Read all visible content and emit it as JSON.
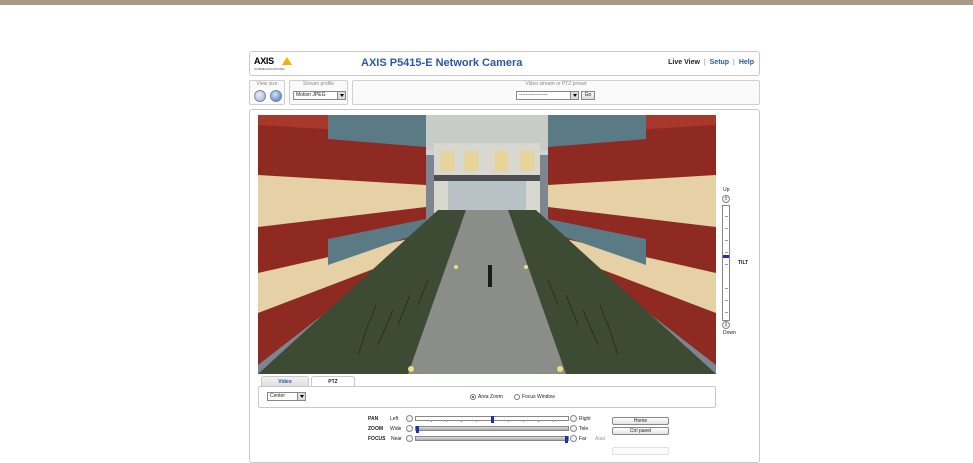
{
  "header": {
    "logo_text": "AXIS",
    "logo_sub": "COMMUNICATIONS",
    "title": "AXIS P5415-E Network Camera",
    "links": {
      "live_view": "Live View",
      "setup": "Setup",
      "help": "Help",
      "sep": "|"
    }
  },
  "toolbar": {
    "view_size_label": "View size",
    "stream_profile_label": "Stream profile",
    "stream_profile_value": "Motion JPEG",
    "preset_label": "Video stream or PTZ preset",
    "preset_value": "-----------------",
    "go_label": "Go"
  },
  "tilt": {
    "up": "Up",
    "down": "Down",
    "label": "TILT",
    "level": 0.55
  },
  "tabs": {
    "video": "Video",
    "ptz": "PTZ",
    "active": "PTZ"
  },
  "ptz": {
    "mode_value": "Center",
    "area_zoom_label": "Area Zoom",
    "focus_window_label": "Focus Window",
    "selected_mode": "Area Zoom",
    "pan": {
      "name": "PAN",
      "low": "Left",
      "high": "Right",
      "level": 0.5
    },
    "zoom": {
      "name": "ZOOM",
      "low": "Wide",
      "high": "Tele",
      "level": 0.0
    },
    "focus": {
      "name": "FOCUS",
      "low": "Near",
      "high": "Far",
      "auto": "Auto",
      "level": 1.0
    },
    "home_label": "Home",
    "ctrl_panel_label": "Ctrl panel"
  },
  "colors": {
    "accent": "#2b58a6",
    "slider_handle": "#1d2fae",
    "top_bar": "#a89a89"
  }
}
